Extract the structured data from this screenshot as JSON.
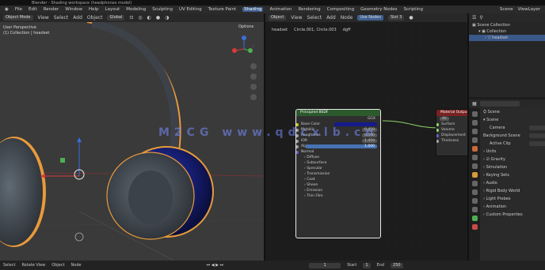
{
  "title": "Blender - Shading workspace (headphones model)",
  "menu": [
    "File",
    "Edit",
    "Render",
    "Window",
    "Help"
  ],
  "workspaces": [
    "Layout",
    "Modeling",
    "Sculpting",
    "UV Editing",
    "Texture Paint",
    "Shading",
    "Animation",
    "Rendering",
    "Compositing",
    "Geometry Nodes",
    "Scripting"
  ],
  "active_workspace": "Shading",
  "scene": "Scene",
  "view_layer": "ViewLayer",
  "viewport": {
    "mode": "Object Mode",
    "menus": [
      "View",
      "Select",
      "Add",
      "Object"
    ],
    "info_line1": "User Perspective",
    "info_line2": "(1) Collection | headset",
    "transform_label": "Global",
    "options": "Options"
  },
  "node_editor": {
    "object": "Object",
    "menus": [
      "View",
      "Select",
      "Add",
      "Node"
    ],
    "use_nodes_label": "Use Nodes",
    "slot": "Slot 3",
    "breadcrumb": [
      "headset",
      "Circle.001, Circle.003",
      "dgff"
    ],
    "bsdf_node": {
      "title": "Principled BSDF",
      "top": "GGX",
      "rows": [
        {
          "label": "Base Color",
          "val": ""
        },
        {
          "label": "Metallic",
          "val": "0.450"
        },
        {
          "label": "Roughness",
          "val": "0.500"
        },
        {
          "label": "IOR",
          "val": "1.450"
        },
        {
          "label": "Alpha",
          "val": "1.000"
        },
        {
          "label": "Normal",
          "val": ""
        }
      ],
      "panels": [
        "Diffuse",
        "Subsurface",
        "Specular",
        "Transmission",
        "Coat",
        "Sheen",
        "Emission",
        "Thin Film"
      ]
    },
    "output_node": {
      "title": "Material Output",
      "select": "All",
      "rows": [
        "Surface",
        "Volume",
        "Displacement",
        "Thickness"
      ]
    }
  },
  "outliner": {
    "rows": [
      {
        "label": "Scene Collection",
        "indent": 0,
        "sel": false
      },
      {
        "label": "Collection",
        "indent": 1,
        "sel": false
      },
      {
        "label": "headset",
        "indent": 2,
        "sel": true
      }
    ]
  },
  "properties": {
    "search": "",
    "scene_label": "Scene",
    "rows": [
      {
        "label": "Scene",
        "field": false
      },
      {
        "label": "Camera",
        "field": true
      },
      {
        "label": "Background Scene",
        "field": true
      },
      {
        "label": "Active Clip",
        "field": true
      },
      {
        "label": "Units",
        "field": false
      },
      {
        "label": "Gravity",
        "field": false
      },
      {
        "label": "Simulation",
        "field": false
      },
      {
        "label": "Keying Sets",
        "field": false
      },
      {
        "label": "Audio",
        "field": false
      },
      {
        "label": "Rigid Body World",
        "field": false
      },
      {
        "label": "Light Probes",
        "field": false
      },
      {
        "label": "Animation",
        "field": false
      },
      {
        "label": "Custom Properties",
        "field": false
      }
    ]
  },
  "statusbar": {
    "items": [
      "Select",
      "Rotate View",
      "Object",
      "Node"
    ],
    "frame": "1",
    "start": "Start",
    "start_val": "1",
    "end": "End",
    "end_val": "250"
  },
  "watermark": "M2CG  www.qdcxlb.cn",
  "colors": {
    "accent": "#3f5f8f",
    "bsdf_header": "#2d5a2d",
    "output_header": "#7a2222",
    "outline": "#e89a3a"
  }
}
